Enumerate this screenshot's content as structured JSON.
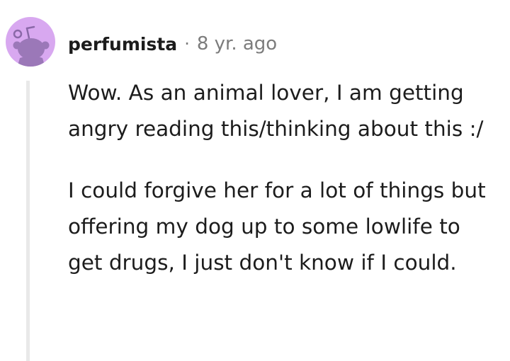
{
  "comment": {
    "author": "perfumista",
    "separator": "·",
    "timestamp": "8 yr. ago",
    "avatar_icon": "reddit-snoo-avatar-icon",
    "avatar_color": "#d8a8f0",
    "paragraphs": [
      "Wow. As an animal lover, I am getting angry reading this/thinking about this :/",
      "I could forgive her for a lot of things but offering my dog up to some lowlife to get drugs, I just don't know if I could."
    ]
  }
}
